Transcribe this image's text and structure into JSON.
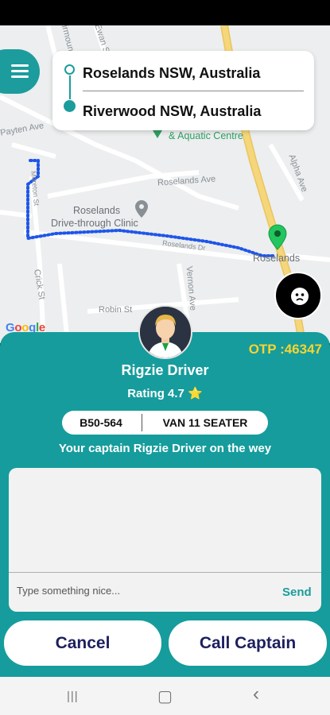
{
  "route": {
    "origin": "Roselands NSW, Australia",
    "destination": "Riverwood NSW, Australia"
  },
  "map": {
    "labels": {
      "aquatic": "& Aquatic Centre",
      "roselands_ave": "Roselands Ave",
      "clinic_line1": "Roselands",
      "clinic_line2": "Drive-through Clinic",
      "roselands": "Roselands",
      "bexley_road": "Roselands Dr",
      "payten_ave": "Payten Ave",
      "moreton": "Moreton St",
      "crick": "Crick St",
      "robin": "Robin St",
      "vernon": "Vernon Ave",
      "avenue": "Alpha Ave",
      "ewan": "Ewan St",
      "fairmount": "Fairmount St"
    },
    "google_logo": [
      "G",
      "o",
      "o",
      "g",
      "l",
      "e"
    ],
    "colors": {
      "route": "#1e56e8",
      "highway": "#f5d67b",
      "pin": "#22c55e"
    }
  },
  "trip": {
    "otp_label": "OTP :46347",
    "driver_name": "Rigzie Driver",
    "rating_label": "Rating 4.7",
    "rating_icon": "⭐",
    "vehicle_plate": "B50-564",
    "vehicle_type": "VAN 11 SEATER",
    "status_message": "Your captain Rigzie Driver on the wey"
  },
  "chat": {
    "placeholder": "Type something nice...",
    "send_label": "Send"
  },
  "actions": {
    "cancel_label": "Cancel",
    "call_label": "Call Captain"
  },
  "nav": {
    "recents_icon": "|||",
    "home_icon": "▢",
    "back_icon": "‹"
  },
  "theme": {
    "accent": "#169c9c",
    "otp": "#f7d431",
    "button_text": "#1d1f5e"
  }
}
